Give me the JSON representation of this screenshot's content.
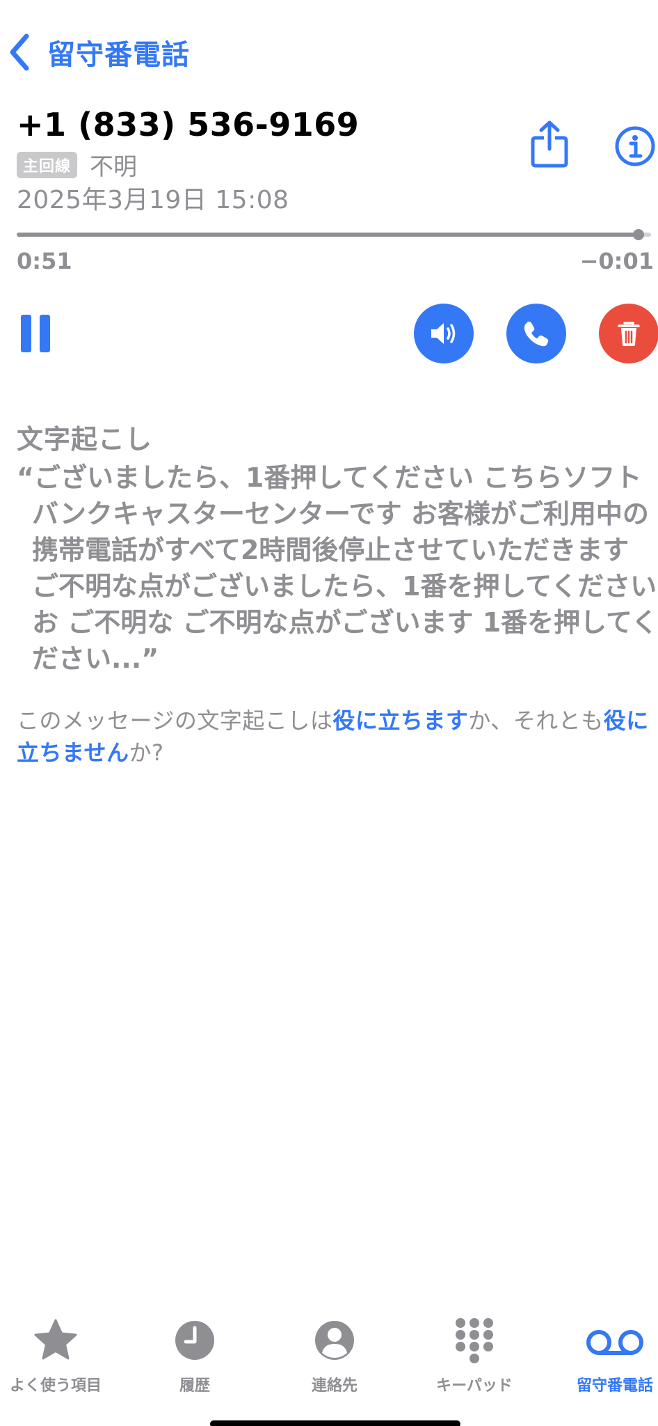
{
  "nav": {
    "back_label": "留守番電話"
  },
  "header": {
    "phone_number": "+1 (833) 536-9169",
    "line_badge": "主回線",
    "line_name": "不明",
    "date": "2025年3月19日 15:08"
  },
  "playback": {
    "elapsed": "0:51",
    "remaining": "−0:01",
    "progress": 0.98
  },
  "transcript": {
    "title": "文字起こし",
    "text": "“ございましたら、1番押してください こちらソフトバンクキャスターセンターです お客様がご利用中の携帯電話がすべて2時間後停止させていただきます ご不明な点がございましたら、1番を押してください お ご不明な ご不明な点がございます 1番を押してください...”"
  },
  "feedback": {
    "prefix": "このメッセージの文字起こしは",
    "helpful_link": "役に立ちます",
    "middle": "か、それとも",
    "not_helpful_link": "役に立ちません",
    "suffix": "か?"
  },
  "tabs": [
    {
      "label": "よく使う項目",
      "icon": "star-icon",
      "active": false
    },
    {
      "label": "履歴",
      "icon": "clock-icon",
      "active": false
    },
    {
      "label": "連絡先",
      "icon": "person-icon",
      "active": false
    },
    {
      "label": "キーパッド",
      "icon": "keypad-icon",
      "active": false
    },
    {
      "label": "留守番電話",
      "icon": "voicemail-icon",
      "active": true
    }
  ],
  "colors": {
    "accent": "#3478F6",
    "destructive": "#EB4D3D",
    "secondary_text": "#8e8e93"
  }
}
